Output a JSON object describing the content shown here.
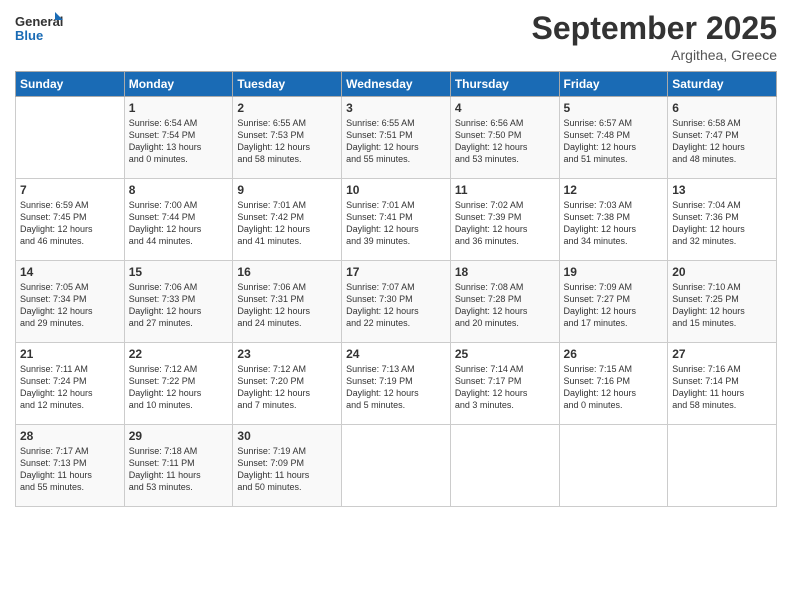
{
  "logo": {
    "line1": "General",
    "line2": "Blue"
  },
  "title": "September 2025",
  "subtitle": "Argithea, Greece",
  "header": {
    "days": [
      "Sunday",
      "Monday",
      "Tuesday",
      "Wednesday",
      "Thursday",
      "Friday",
      "Saturday"
    ]
  },
  "weeks": [
    [
      {
        "day": "",
        "info": ""
      },
      {
        "day": "1",
        "info": "Sunrise: 6:54 AM\nSunset: 7:54 PM\nDaylight: 13 hours\nand 0 minutes."
      },
      {
        "day": "2",
        "info": "Sunrise: 6:55 AM\nSunset: 7:53 PM\nDaylight: 12 hours\nand 58 minutes."
      },
      {
        "day": "3",
        "info": "Sunrise: 6:55 AM\nSunset: 7:51 PM\nDaylight: 12 hours\nand 55 minutes."
      },
      {
        "day": "4",
        "info": "Sunrise: 6:56 AM\nSunset: 7:50 PM\nDaylight: 12 hours\nand 53 minutes."
      },
      {
        "day": "5",
        "info": "Sunrise: 6:57 AM\nSunset: 7:48 PM\nDaylight: 12 hours\nand 51 minutes."
      },
      {
        "day": "6",
        "info": "Sunrise: 6:58 AM\nSunset: 7:47 PM\nDaylight: 12 hours\nand 48 minutes."
      }
    ],
    [
      {
        "day": "7",
        "info": "Sunrise: 6:59 AM\nSunset: 7:45 PM\nDaylight: 12 hours\nand 46 minutes."
      },
      {
        "day": "8",
        "info": "Sunrise: 7:00 AM\nSunset: 7:44 PM\nDaylight: 12 hours\nand 44 minutes."
      },
      {
        "day": "9",
        "info": "Sunrise: 7:01 AM\nSunset: 7:42 PM\nDaylight: 12 hours\nand 41 minutes."
      },
      {
        "day": "10",
        "info": "Sunrise: 7:01 AM\nSunset: 7:41 PM\nDaylight: 12 hours\nand 39 minutes."
      },
      {
        "day": "11",
        "info": "Sunrise: 7:02 AM\nSunset: 7:39 PM\nDaylight: 12 hours\nand 36 minutes."
      },
      {
        "day": "12",
        "info": "Sunrise: 7:03 AM\nSunset: 7:38 PM\nDaylight: 12 hours\nand 34 minutes."
      },
      {
        "day": "13",
        "info": "Sunrise: 7:04 AM\nSunset: 7:36 PM\nDaylight: 12 hours\nand 32 minutes."
      }
    ],
    [
      {
        "day": "14",
        "info": "Sunrise: 7:05 AM\nSunset: 7:34 PM\nDaylight: 12 hours\nand 29 minutes."
      },
      {
        "day": "15",
        "info": "Sunrise: 7:06 AM\nSunset: 7:33 PM\nDaylight: 12 hours\nand 27 minutes."
      },
      {
        "day": "16",
        "info": "Sunrise: 7:06 AM\nSunset: 7:31 PM\nDaylight: 12 hours\nand 24 minutes."
      },
      {
        "day": "17",
        "info": "Sunrise: 7:07 AM\nSunset: 7:30 PM\nDaylight: 12 hours\nand 22 minutes."
      },
      {
        "day": "18",
        "info": "Sunrise: 7:08 AM\nSunset: 7:28 PM\nDaylight: 12 hours\nand 20 minutes."
      },
      {
        "day": "19",
        "info": "Sunrise: 7:09 AM\nSunset: 7:27 PM\nDaylight: 12 hours\nand 17 minutes."
      },
      {
        "day": "20",
        "info": "Sunrise: 7:10 AM\nSunset: 7:25 PM\nDaylight: 12 hours\nand 15 minutes."
      }
    ],
    [
      {
        "day": "21",
        "info": "Sunrise: 7:11 AM\nSunset: 7:24 PM\nDaylight: 12 hours\nand 12 minutes."
      },
      {
        "day": "22",
        "info": "Sunrise: 7:12 AM\nSunset: 7:22 PM\nDaylight: 12 hours\nand 10 minutes."
      },
      {
        "day": "23",
        "info": "Sunrise: 7:12 AM\nSunset: 7:20 PM\nDaylight: 12 hours\nand 7 minutes."
      },
      {
        "day": "24",
        "info": "Sunrise: 7:13 AM\nSunset: 7:19 PM\nDaylight: 12 hours\nand 5 minutes."
      },
      {
        "day": "25",
        "info": "Sunrise: 7:14 AM\nSunset: 7:17 PM\nDaylight: 12 hours\nand 3 minutes."
      },
      {
        "day": "26",
        "info": "Sunrise: 7:15 AM\nSunset: 7:16 PM\nDaylight: 12 hours\nand 0 minutes."
      },
      {
        "day": "27",
        "info": "Sunrise: 7:16 AM\nSunset: 7:14 PM\nDaylight: 11 hours\nand 58 minutes."
      }
    ],
    [
      {
        "day": "28",
        "info": "Sunrise: 7:17 AM\nSunset: 7:13 PM\nDaylight: 11 hours\nand 55 minutes."
      },
      {
        "day": "29",
        "info": "Sunrise: 7:18 AM\nSunset: 7:11 PM\nDaylight: 11 hours\nand 53 minutes."
      },
      {
        "day": "30",
        "info": "Sunrise: 7:19 AM\nSunset: 7:09 PM\nDaylight: 11 hours\nand 50 minutes."
      },
      {
        "day": "",
        "info": ""
      },
      {
        "day": "",
        "info": ""
      },
      {
        "day": "",
        "info": ""
      },
      {
        "day": "",
        "info": ""
      }
    ]
  ]
}
